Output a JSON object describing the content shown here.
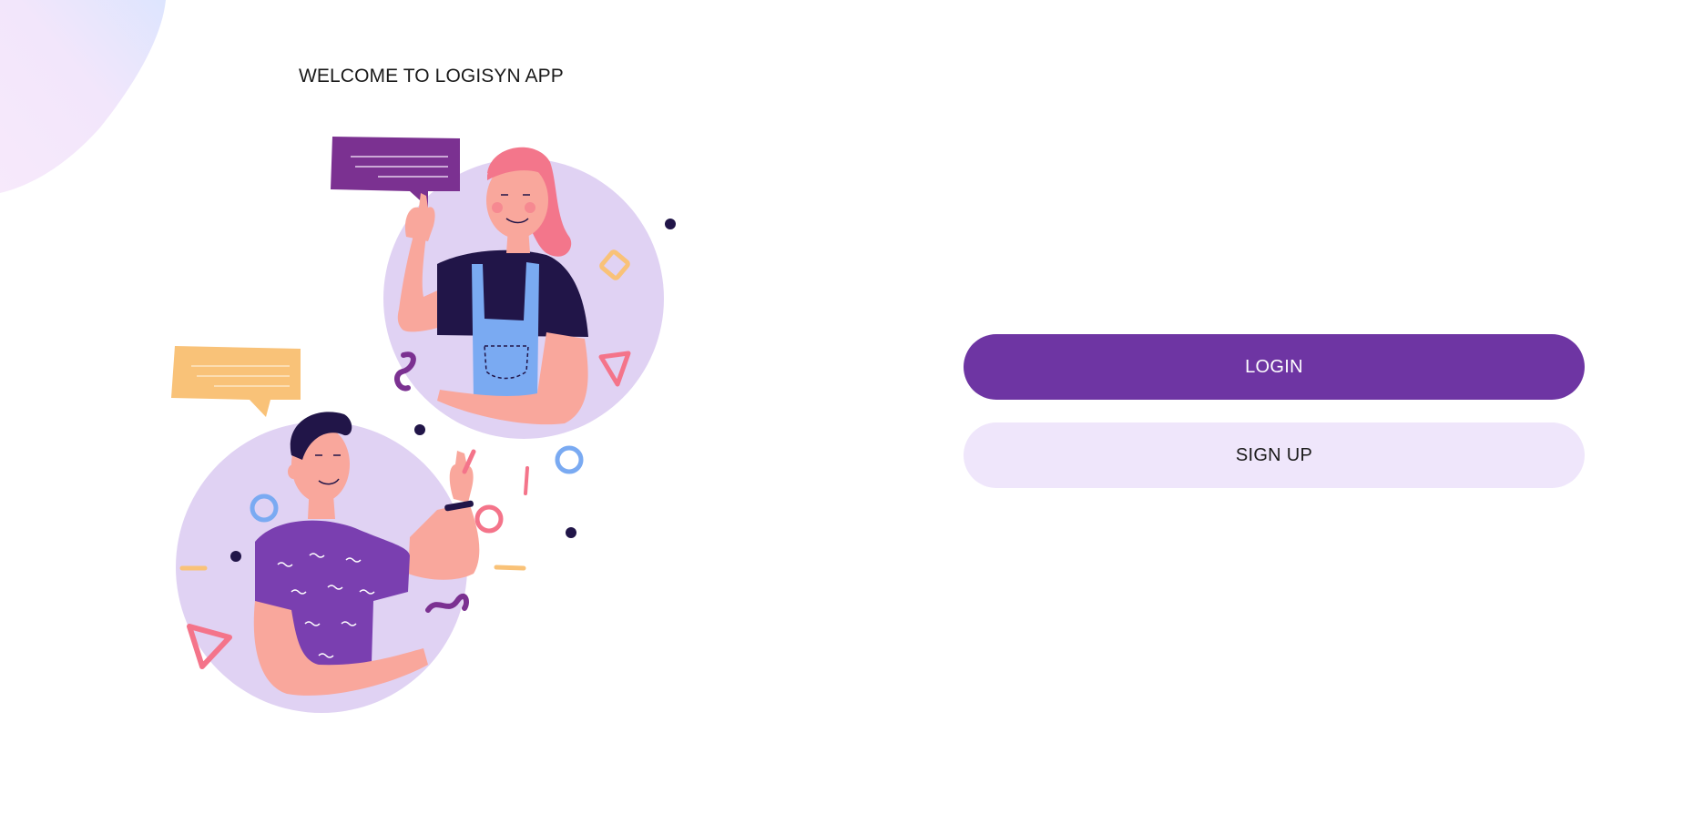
{
  "header": {
    "title": "WELCOME TO LOGISYN APP"
  },
  "actions": {
    "login_label": "LOGIN",
    "signup_label": "SIGN UP"
  },
  "colors": {
    "primary": "#6e35a3",
    "secondary_bg": "#efe6fb",
    "circle_bg": "#e0d2f3",
    "accent_pink": "#f4748a",
    "accent_yellow": "#f9c278",
    "accent_blue": "#7aaaf2",
    "dark_navy": "#211548"
  },
  "illustration": {
    "name": "two-people-chatting-illustration"
  }
}
